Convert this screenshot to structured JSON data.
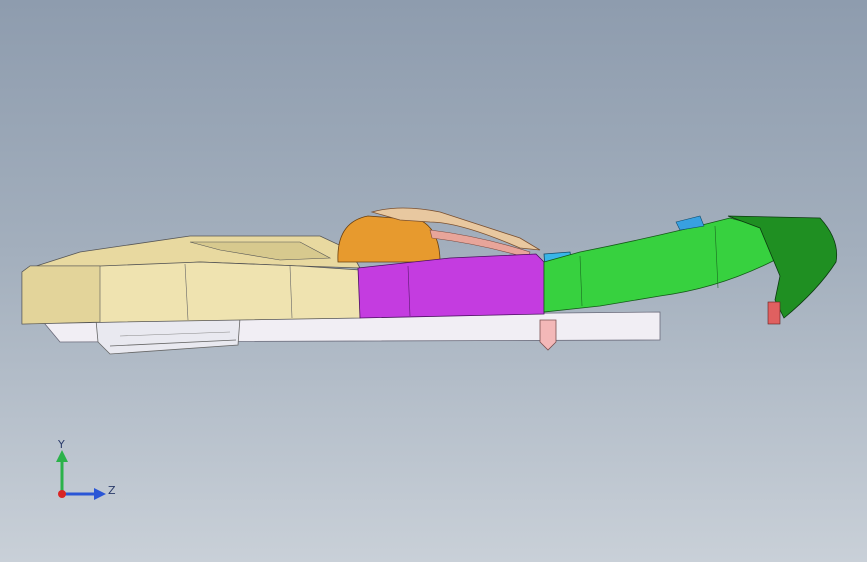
{
  "viewport": {
    "background_top": "#8e9cae",
    "background_bottom": "#c9d0d8"
  },
  "model": {
    "parts": [
      {
        "name": "front-housing",
        "color": "#efe3b0"
      },
      {
        "name": "top-cover",
        "color": "#e8d9a0"
      },
      {
        "name": "orange-bracket",
        "color": "#e79a2e"
      },
      {
        "name": "magenta-panel",
        "color": "#c43ce0"
      },
      {
        "name": "cyan-clip",
        "color": "#38b6e8"
      },
      {
        "name": "green-arm",
        "color": "#37d13f"
      },
      {
        "name": "dark-green-end",
        "color": "#1f8f22"
      },
      {
        "name": "base-plate",
        "color": "#f2eef3"
      }
    ]
  },
  "triad": {
    "y_label": "Y",
    "z_label": "Z",
    "y_color": "#2bb24a",
    "z_color": "#2a56d6",
    "origin_color": "#d92525"
  }
}
